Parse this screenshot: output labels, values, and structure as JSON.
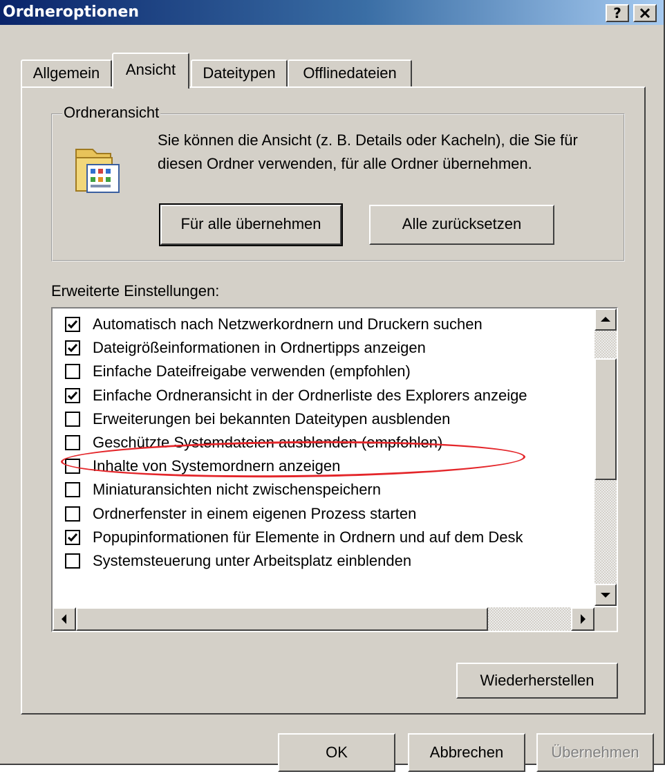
{
  "window": {
    "title": "Ordneroptionen",
    "help_label": "?",
    "close_label": "✕"
  },
  "tabs": [
    {
      "label": "Allgemein",
      "active": false
    },
    {
      "label": "Ansicht",
      "active": true
    },
    {
      "label": "Dateitypen",
      "active": false
    },
    {
      "label": "Offlinedateien",
      "active": false
    }
  ],
  "folder_view": {
    "legend": "Ordneransicht",
    "description": "Sie können die Ansicht (z. B. Details oder Kacheln), die Sie für diesen Ordner verwenden, für alle Ordner übernehmen.",
    "apply_all_label": "Für alle übernehmen",
    "reset_all_label": "Alle zurücksetzen",
    "icon": "folder-view-icon"
  },
  "advanced": {
    "label": "Erweiterte Einstellungen:",
    "items": [
      {
        "label": "Automatisch nach Netzwerkordnern und Druckern suchen",
        "checked": true
      },
      {
        "label": "Dateigrößeinformationen in Ordnertipps anzeigen",
        "checked": true
      },
      {
        "label": "Einfache Dateifreigabe verwenden (empfohlen)",
        "checked": false
      },
      {
        "label": "Einfache Ordneransicht in der Ordnerliste des Explorers anzeige",
        "checked": true
      },
      {
        "label": "Erweiterungen bei bekannten Dateitypen ausblenden",
        "checked": false
      },
      {
        "label": "Geschützte Systemdateien ausblenden (empfohlen)",
        "checked": false,
        "highlighted": true
      },
      {
        "label": "Inhalte von Systemordnern anzeigen",
        "checked": false
      },
      {
        "label": "Miniaturansichten nicht zwischenspeichern",
        "checked": false
      },
      {
        "label": "Ordnerfenster in einem eigenen Prozess starten",
        "checked": false
      },
      {
        "label": "Popupinformationen für Elemente in Ordnern und auf dem Desk",
        "checked": true
      },
      {
        "label": "Systemsteuerung unter Arbeitsplatz einblenden",
        "checked": false
      }
    ],
    "restore_label": "Wiederherstellen"
  },
  "footer": {
    "ok_label": "OK",
    "cancel_label": "Abbrechen",
    "apply_label": "Übernehmen",
    "apply_enabled": false
  },
  "colors": {
    "title_gradient_start": "#0a246a",
    "title_gradient_end": "#a6caf0",
    "face": "#d4d0c8",
    "highlight_ellipse": "#e4262a"
  }
}
